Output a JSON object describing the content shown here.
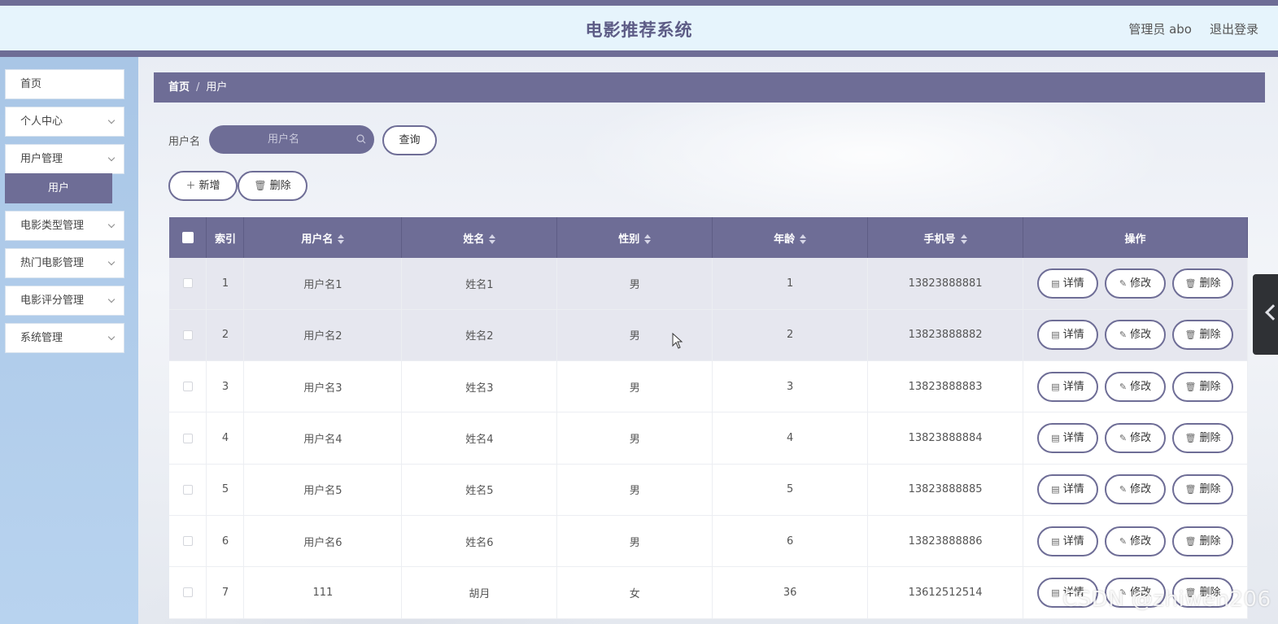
{
  "header": {
    "title": "电影推荐系统",
    "user": "管理员 abo",
    "logout": "退出登录"
  },
  "sidebar": {
    "items": [
      {
        "label": "首页",
        "has_chevron": false
      },
      {
        "label": "个人中心",
        "has_chevron": true
      },
      {
        "label": "用户管理",
        "has_chevron": true
      },
      {
        "label": "电影类型管理",
        "has_chevron": true
      },
      {
        "label": "热门电影管理",
        "has_chevron": true
      },
      {
        "label": "电影评分管理",
        "has_chevron": true
      },
      {
        "label": "系统管理",
        "has_chevron": true
      }
    ],
    "active_submenu": "用户"
  },
  "breadcrumb": {
    "home": "首页",
    "separator": "/",
    "current": "用户"
  },
  "search": {
    "label": "用户名",
    "placeholder": "用户名",
    "query_button": "查询"
  },
  "actions": {
    "add": "新增",
    "delete": "删除"
  },
  "table": {
    "columns": [
      "索引",
      "用户名",
      "姓名",
      "性别",
      "年龄",
      "手机号",
      "操作"
    ],
    "row_buttons": {
      "detail": "详情",
      "edit": "修改",
      "delete": "删除"
    },
    "rows": [
      {
        "index": "1",
        "username": "用户名1",
        "name": "姓名1",
        "gender": "男",
        "age": "1",
        "phone": "13823888881"
      },
      {
        "index": "2",
        "username": "用户名2",
        "name": "姓名2",
        "gender": "男",
        "age": "2",
        "phone": "13823888882"
      },
      {
        "index": "3",
        "username": "用户名3",
        "name": "姓名3",
        "gender": "男",
        "age": "3",
        "phone": "13823888883"
      },
      {
        "index": "4",
        "username": "用户名4",
        "name": "姓名4",
        "gender": "男",
        "age": "4",
        "phone": "13823888884"
      },
      {
        "index": "5",
        "username": "用户名5",
        "name": "姓名5",
        "gender": "男",
        "age": "5",
        "phone": "13823888885"
      },
      {
        "index": "6",
        "username": "用户名6",
        "name": "姓名6",
        "gender": "男",
        "age": "6",
        "phone": "13823888886"
      },
      {
        "index": "7",
        "username": "111",
        "name": "胡月",
        "gender": "女",
        "age": "36",
        "phone": "13612512514"
      }
    ]
  },
  "watermark": "CSDN @zhiwen206",
  "colors": {
    "primary": "#6e6d96",
    "header_bg": "#e6f4fc",
    "sidebar_bg": "#b3cfec"
  }
}
